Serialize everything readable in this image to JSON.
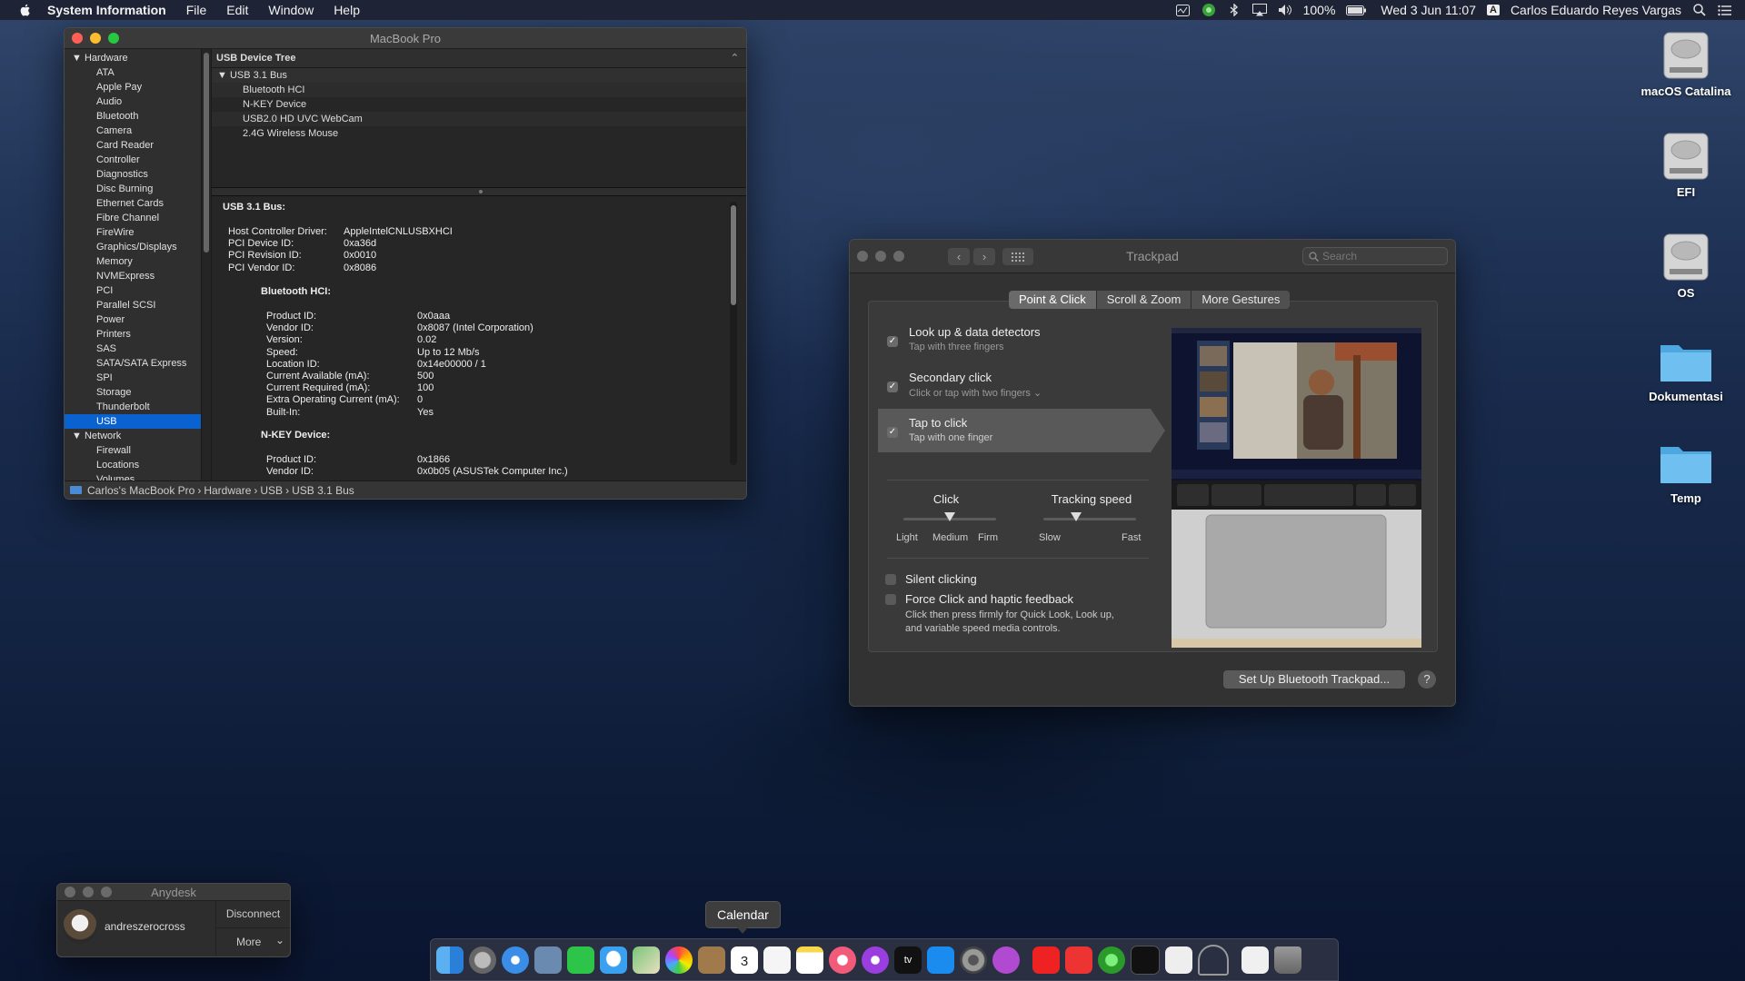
{
  "menubar": {
    "app": "System Information",
    "menus": [
      "File",
      "Edit",
      "Window",
      "Help"
    ],
    "battery": "100%",
    "datetime": "Wed 3 Jun  11:07",
    "input_source": "A",
    "user": "Carlos Eduardo Reyes Vargas"
  },
  "sysinfo": {
    "title": "MacBook Pro",
    "sidebar": {
      "hardware": "Hardware",
      "hardware_items": [
        "ATA",
        "Apple Pay",
        "Audio",
        "Bluetooth",
        "Camera",
        "Card Reader",
        "Controller",
        "Diagnostics",
        "Disc Burning",
        "Ethernet Cards",
        "Fibre Channel",
        "FireWire",
        "Graphics/Displays",
        "Memory",
        "NVMExpress",
        "PCI",
        "Parallel SCSI",
        "Power",
        "Printers",
        "SAS",
        "SATA/SATA Express",
        "SPI",
        "Storage",
        "Thunderbolt",
        "USB"
      ],
      "network": "Network",
      "network_items": [
        "Firewall",
        "Locations",
        "Volumes"
      ]
    },
    "tree": {
      "header": "USB Device Tree",
      "bus": "USB 3.1 Bus",
      "devices": [
        "Bluetooth HCI",
        "N-KEY Device",
        "USB2.0 HD UVC WebCam",
        "2.4G Wireless Mouse"
      ]
    },
    "detail": {
      "bus_title": "USB 3.1 Bus:",
      "bus_props": [
        {
          "k": "Host Controller Driver:",
          "v": "AppleIntelCNLUSBXHCI"
        },
        {
          "k": "PCI Device ID:",
          "v": "0xa36d"
        },
        {
          "k": "PCI Revision ID:",
          "v": "0x0010"
        },
        {
          "k": "PCI Vendor ID:",
          "v": "0x8086"
        }
      ],
      "bt_title": "Bluetooth HCI:",
      "bt_props": [
        {
          "k": "Product ID:",
          "v": "0x0aaa"
        },
        {
          "k": "Vendor ID:",
          "v": "0x8087  (Intel Corporation)"
        },
        {
          "k": "Version:",
          "v": "0.02"
        },
        {
          "k": "Speed:",
          "v": "Up to 12 Mb/s"
        },
        {
          "k": "Location ID:",
          "v": "0x14e00000 / 1"
        },
        {
          "k": "Current Available (mA):",
          "v": "500"
        },
        {
          "k": "Current Required (mA):",
          "v": "100"
        },
        {
          "k": "Extra Operating Current (mA):",
          "v": "0"
        },
        {
          "k": "Built-In:",
          "v": "Yes"
        }
      ],
      "nkey_title": "N-KEY Device:",
      "nkey_props": [
        {
          "k": "Product ID:",
          "v": "0x1866"
        },
        {
          "k": "Vendor ID:",
          "v": "0x0b05  (ASUSTek Computer Inc.)"
        }
      ]
    },
    "path": [
      "Carlos's MacBook Pro",
      "Hardware",
      "USB",
      "USB 3.1 Bus"
    ]
  },
  "trackpad": {
    "title": "Trackpad",
    "search_placeholder": "Search",
    "tabs": [
      "Point & Click",
      "Scroll & Zoom",
      "More Gestures"
    ],
    "options": [
      {
        "title": "Look up & data detectors",
        "sub": "Tap with three fingers"
      },
      {
        "title": "Secondary click",
        "sub": "Click or tap with two fingers"
      },
      {
        "title": "Tap to click",
        "sub": "Tap with one finger"
      }
    ],
    "click": {
      "label": "Click",
      "ticks": [
        "Light",
        "Medium",
        "Firm"
      ],
      "value": 0.5
    },
    "tracking": {
      "label": "Tracking speed",
      "ticks": [
        "Slow",
        "Fast"
      ],
      "value": 0.35
    },
    "silent": "Silent clicking",
    "force": "Force Click and haptic feedback",
    "force_desc_1": "Click then press firmly for Quick Look, Look up,",
    "force_desc_2": "and variable speed media controls.",
    "setup_button": "Set Up Bluetooth Trackpad...",
    "help": "?"
  },
  "anydesk": {
    "title": "Anydesk",
    "user": "andreszerocross",
    "disconnect": "Disconnect",
    "more": "More"
  },
  "desktop": [
    "macOS Catalina",
    "EFI",
    "OS",
    "Dokumentasi",
    "Temp"
  ],
  "dock": {
    "tooltip": "Calendar",
    "calendar_day": "3",
    "appletv": "tv"
  },
  "colors": {
    "accent": "#0a62d0",
    "close": "#ff5f57",
    "minimize": "#febc2e",
    "zoom": "#28c840"
  }
}
